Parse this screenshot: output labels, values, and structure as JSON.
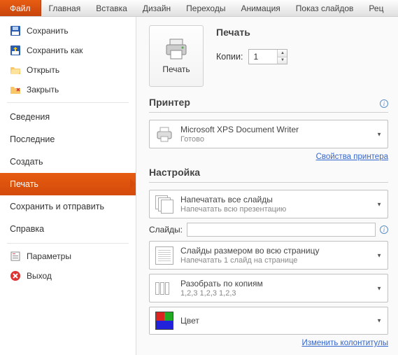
{
  "ribbon": {
    "file": "Файл",
    "tabs": [
      "Главная",
      "Вставка",
      "Дизайн",
      "Переходы",
      "Анимация",
      "Показ слайдов",
      "Рец"
    ]
  },
  "sidebar": {
    "save": "Сохранить",
    "save_as": "Сохранить как",
    "open": "Открыть",
    "close": "Закрыть",
    "info": "Сведения",
    "recent": "Последние",
    "new": "Создать",
    "print": "Печать",
    "share": "Сохранить и отправить",
    "help": "Справка",
    "options": "Параметры",
    "exit": "Выход"
  },
  "print": {
    "title": "Печать",
    "button": "Печать",
    "copies_label": "Копии:",
    "copies_value": "1"
  },
  "printer": {
    "title": "Принтер",
    "name": "Microsoft XPS Document Writer",
    "status": "Готово",
    "props_link": "Свойства принтера"
  },
  "settings": {
    "title": "Настройка",
    "all_slides": {
      "title": "Напечатать все слайды",
      "sub": "Напечатать всю презентацию"
    },
    "slides_label": "Слайды:",
    "slides_value": "",
    "full_page": {
      "title": "Слайды размером во всю страницу",
      "sub": "Напечатать 1 слайд на странице"
    },
    "collate": {
      "title": "Разобрать по копиям",
      "sub": "1,2,3    1,2,3    1,2,3"
    },
    "color": {
      "title": "Цвет"
    },
    "footer_link": "Изменить колонтитулы"
  }
}
